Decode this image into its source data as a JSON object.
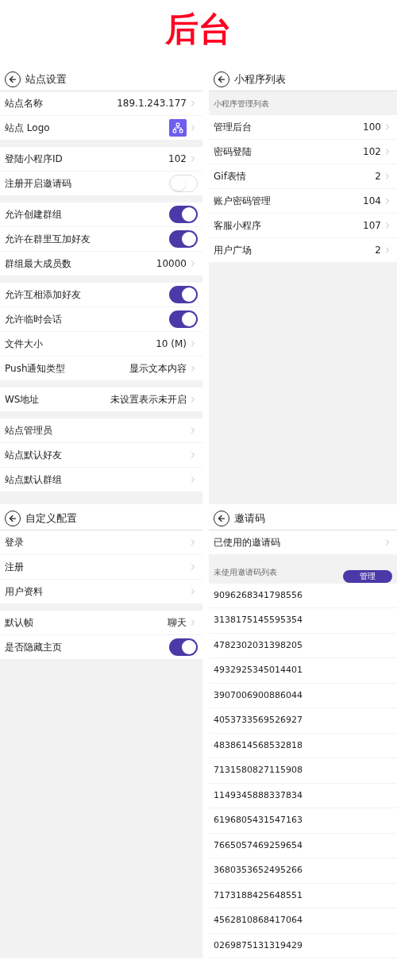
{
  "title": "后台",
  "panels": [
    {
      "title": "站点设置",
      "blocks": [
        {
          "kind": "group",
          "items": [
            {
              "kind": "value",
              "label": "站点名称",
              "value": "189.1.243.177"
            },
            {
              "kind": "logo",
              "label": "站点 Logo"
            }
          ]
        },
        {
          "kind": "group",
          "items": [
            {
              "kind": "value",
              "label": "登陆小程序ID",
              "value": "102"
            },
            {
              "kind": "toggle",
              "label": "注册开启邀请码",
              "on": false
            }
          ]
        },
        {
          "kind": "group",
          "items": [
            {
              "kind": "toggle",
              "label": "允许创建群组",
              "on": true
            },
            {
              "kind": "toggle",
              "label": "允许在群里互加好友",
              "on": true
            },
            {
              "kind": "value",
              "label": "群组最大成员数",
              "value": "10000"
            }
          ]
        },
        {
          "kind": "group",
          "items": [
            {
              "kind": "toggle",
              "label": "允许互相添加好友",
              "on": true
            },
            {
              "kind": "toggle",
              "label": "允许临时会话",
              "on": true
            },
            {
              "kind": "value",
              "label": "文件大小",
              "value": "10 (M)"
            },
            {
              "kind": "value",
              "label": "Push通知类型",
              "value": "显示文本内容"
            }
          ]
        },
        {
          "kind": "group",
          "items": [
            {
              "kind": "value",
              "label": "WS地址",
              "value": "未设置表示未开启"
            }
          ]
        },
        {
          "kind": "group",
          "items": [
            {
              "kind": "value",
              "label": "站点管理员"
            },
            {
              "kind": "value",
              "label": "站点默认好友"
            },
            {
              "kind": "value",
              "label": "站点默认群组"
            }
          ]
        }
      ]
    },
    {
      "title": "小程序列表",
      "blocks": [
        {
          "kind": "subheader",
          "text": "小程序管理列表"
        },
        {
          "kind": "group",
          "items": [
            {
              "kind": "value",
              "label": "管理后台",
              "value": "100"
            },
            {
              "kind": "value",
              "label": "密码登陆",
              "value": "102"
            },
            {
              "kind": "value",
              "label": "Gif表情",
              "value": "2"
            },
            {
              "kind": "value",
              "label": "账户密码管理",
              "value": "104"
            },
            {
              "kind": "value",
              "label": "客服小程序",
              "value": "107"
            },
            {
              "kind": "value",
              "label": "用户广场",
              "value": "2"
            }
          ]
        }
      ]
    },
    {
      "title": "自定义配置",
      "blocks": [
        {
          "kind": "group",
          "items": [
            {
              "kind": "value",
              "label": "登录"
            },
            {
              "kind": "value",
              "label": "注册"
            },
            {
              "kind": "value",
              "label": "用户资料"
            }
          ]
        },
        {
          "kind": "group",
          "items": [
            {
              "kind": "value",
              "label": "默认帧",
              "value": "聊天"
            },
            {
              "kind": "toggle",
              "label": "是否隐藏主页",
              "on": true
            }
          ]
        }
      ]
    },
    {
      "title": "邀请码",
      "blocks": [
        {
          "kind": "group",
          "items": [
            {
              "kind": "value",
              "label": "已使用的邀请码"
            }
          ]
        },
        {
          "kind": "subheader",
          "text": "未使用邀请码列表",
          "button": "管理"
        },
        {
          "kind": "codes",
          "codes": [
            "9096268341798556",
            "3138175145595354",
            "4782302031398205",
            "4932925345014401",
            "3907006900886044",
            "4053733569526927",
            "4838614568532818",
            "7131580827115908",
            "1149345888337834",
            "6196805431547163",
            "7665057469259654",
            "3680353652495266",
            "7173188425648551",
            "4562810868417064",
            "0269875131319429"
          ]
        }
      ]
    }
  ]
}
